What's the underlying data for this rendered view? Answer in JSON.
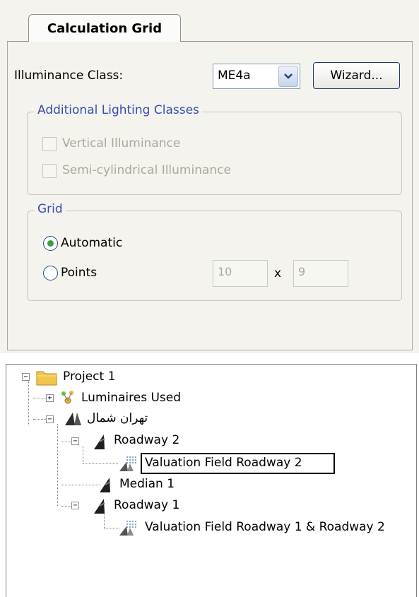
{
  "tab": {
    "label": "Calculation Grid"
  },
  "illuminance": {
    "label": "Illuminance Class:",
    "selected_value": "ME4a",
    "wizard_label": "Wizard..."
  },
  "additional_lighting": {
    "title": "Additional Lighting Classes",
    "options": [
      {
        "label": "Vertical Illuminance",
        "checked": false
      },
      {
        "label": "Semi-cylindrical Illuminance",
        "checked": false
      }
    ]
  },
  "grid": {
    "title": "Grid",
    "automatic_label": "Automatic",
    "points_label": "Points",
    "points_x": "10",
    "separator": "x",
    "points_y": "9"
  },
  "tree": {
    "project": "Project 1",
    "luminaires": "Luminaires Used",
    "street": "تهران شمال",
    "roadway2": "Roadway 2",
    "valuation2": "Valuation Field Roadway 2",
    "median1": "Median 1",
    "roadway1": "Roadway 1",
    "valuation12": "Valuation Field Roadway 1 & Roadway 2"
  },
  "colors": {
    "panel_bg": "#f4f3ee",
    "group_title": "#3a4bb0",
    "radio_selected": "#37a13a",
    "folder": "#f3c64b"
  }
}
